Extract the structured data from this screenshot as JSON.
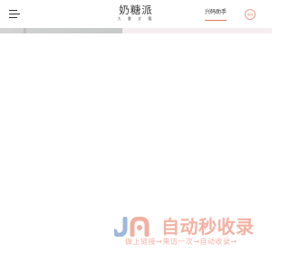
{
  "header": {
    "logo": {
      "title": "奶糖派",
      "subtitle": "大 番 文 籍"
    },
    "assistant_label": "兴码助手",
    "round_button_label": "会员"
  },
  "progress": {
    "value": 0.45
  },
  "brand": {
    "name": "自动秒收录",
    "tagline": "做上链接→来访一次→自动收录→"
  },
  "colors": {
    "accent": "#e0735a",
    "brand": "#f2b2a3",
    "mark_blue": "#9db8dc",
    "mark_pink": "#f1b1a2"
  }
}
